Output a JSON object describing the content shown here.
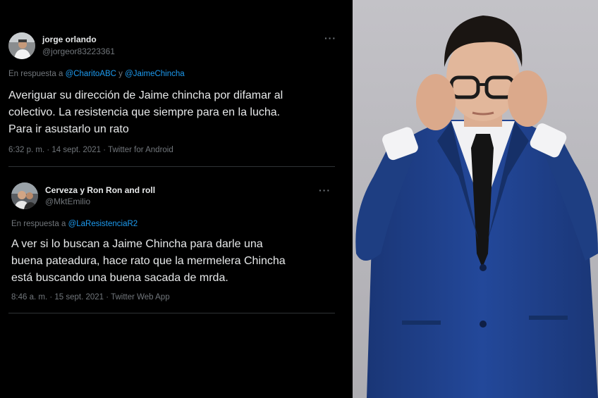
{
  "tweets": [
    {
      "name": "jorge orlando",
      "handle": "@jorgeor83223361",
      "more": "···",
      "reply_prefix": "En respuesta a",
      "reply_mention_1": "@CharitoABC",
      "reply_joiner": "y",
      "reply_mention_2": "@JaimeChincha",
      "text": "Averiguar su dirección de Jaime chincha  por difamar al\ncolectivo. La resistencia que siempre para en la lucha.\nPara ir  asustarlo un rato",
      "meta": "6:32 p. m. · 14 sept. 2021 · Twitter for Android"
    },
    {
      "name": "Cerveza y Ron Ron and roll",
      "handle": "@MktEmilio",
      "more": "···",
      "reply_prefix": "En respuesta a",
      "reply_mention_1": "@LaResistenciaR2",
      "text": "A ver si lo buscan a Jaime Chincha para darle una\nbuena pateadura, hace rato que la mermelera Chincha\nestá buscando una buena sacada de mrda.",
      "meta": "8:46 a. m. · 15 sept. 2021 · Twitter Web App"
    }
  ],
  "colors": {
    "background": "#000000",
    "text": "#e7e9ea",
    "muted": "#71767b",
    "mention": "#1d9bf0",
    "photo_background": "#b8b7bc",
    "suit": "#1f3f86"
  }
}
